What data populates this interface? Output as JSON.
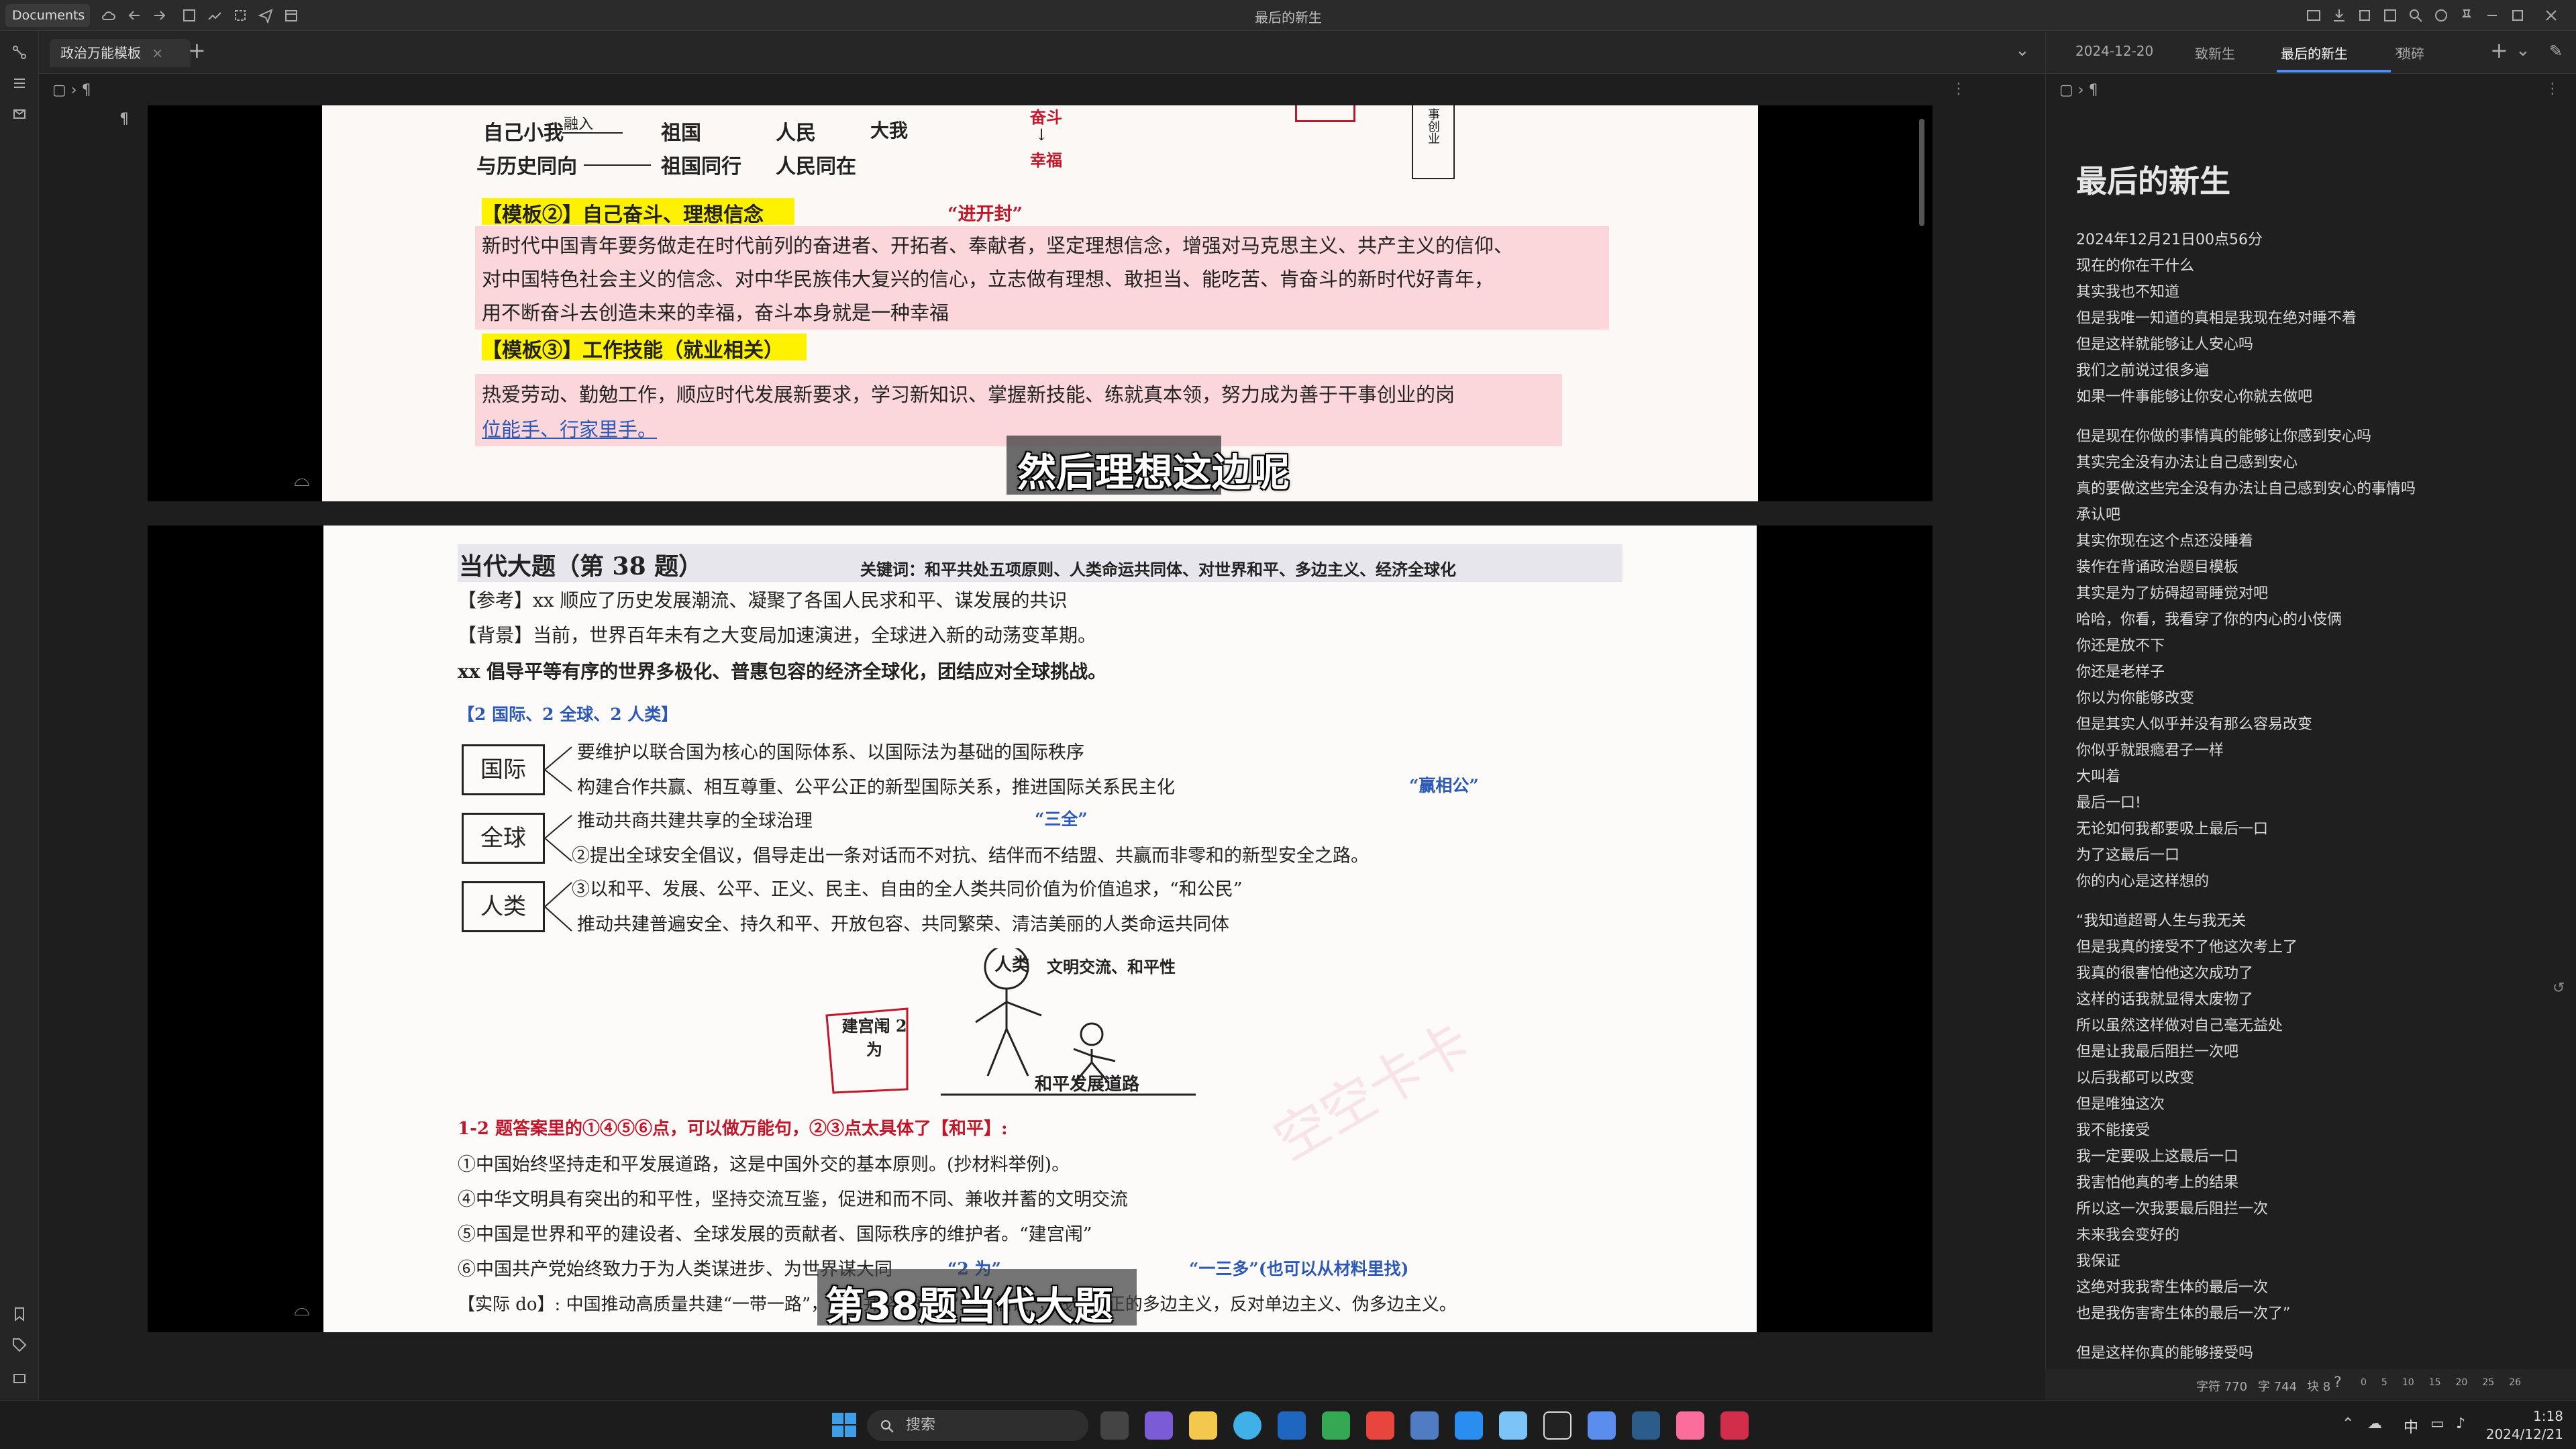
{
  "window": {
    "workspace": "Documents",
    "title": "最后的新生"
  },
  "left_pane": {
    "tab": "政治万能模板",
    "breadcrumb_symbol": "¶"
  },
  "right_pane": {
    "tabs": [
      "2024-12-20",
      "致新生",
      "最后的新生",
      "琐碎"
    ],
    "active_tab": "最后的新生",
    "note_title": "最后的新生",
    "lines": [
      "2024年12月21日00点56分",
      "现在的你在干什么",
      "其实我也不知道",
      "但是我唯一知道的真相是我现在绝对睡不着",
      "但是这样就能够让人安心吗",
      "我们之前说过很多遍",
      "如果一件事能够让你安心你就去做吧",
      "",
      "但是现在你做的事情真的能够让你感到安心吗",
      "其实完全没有办法让自己感到安心",
      "真的要做这些完全没有办法让自己感到安心的事情吗",
      "承认吧",
      "其实你现在这个点还没睡着",
      "装作在背诵政治题目模板",
      "其实是为了妨碍超哥睡觉对吧",
      "哈哈，你看，我看穿了你的内心的小伎俩",
      "你还是放不下",
      "你还是老样子",
      "你以为你能够改变",
      "但是其实人似乎并没有那么容易改变",
      "你似乎就跟瘾君子一样",
      "大叫着",
      "最后一口!",
      "无论如何我都要吸上最后一口",
      "为了这最后一口",
      "你的内心是这样想的",
      "",
      "“我知道超哥人生与我无关",
      "但是我真的接受不了他这次考上了",
      "我真的很害怕他这次成功了",
      "这样的话我就显得太废物了",
      "所以虽然这样做对自己毫无益处",
      "但是让我最后阻拦一次吧",
      "以后我都可以改变",
      "但是唯独这次",
      "我不能接受",
      "我一定要吸上这最后一口",
      "我害怕他真的考上的结果",
      "所以这一次我要最后阻拦一次",
      "未来我会变好的",
      "我保证",
      "这绝对我我寄生体的最后一次",
      "也是我伤害寄生体的最后一次了”",
      "",
      "但是这样你真的能够接受吗"
    ],
    "status": {
      "chars": "字符 770",
      "words": "字 744",
      "blocks": "块 8",
      "ticks": [
        "0",
        "5",
        "10",
        "15",
        "20",
        "25",
        "26"
      ]
    }
  },
  "image1": {
    "row1_left": "自己小我",
    "row1_arrow": "融入",
    "row1_mid": "祖国",
    "row1_right": "人民",
    "row1_far": "大我",
    "row2_left": "与历史同向",
    "row2_mid": "祖国同行",
    "row2_right": "人民同在",
    "arrow_top": "奋斗",
    "arrow_bottom": "幸福",
    "vert_text": "事创业",
    "tpl2_heading": "【模板②】自己奋斗、理想信念",
    "tpl2_tag": "“进开封”",
    "tpl2_line1": "新时代中国青年要务做走在时代前列的奋进者、开拓者、奉献者，坚定理想信念，增强对马克思主义、共产主义的信仰、",
    "tpl2_line2": "对中国特色社会主义的信念、对中华民族伟大复兴的信心，立志做有理想、敢担当、能吃苦、肯奋斗的新时代好青年，",
    "tpl2_line3": "用不断奋斗去创造未来的幸福，奋斗本身就是一种幸福",
    "tpl3_heading": "【模板③】工作技能（就业相关）",
    "tpl3_line1": "热爱劳动、勤勉工作，顺应时代发展新要求，学习新知识、掌握新技能、练就真本领，努力成为善于干事创业的岗",
    "tpl3_line2": "位能手、行家里手。",
    "subtitle": "然后理想这边呢"
  },
  "image2": {
    "title": "当代大题（第 38 题）",
    "keywords": "关键词：和平共处五项原则、人类命运共同体、对世界和平、多边主义、经济全球化",
    "line_cankao": "【参考】xx 顺应了历史发展潮流、凝聚了各国人民求和平、谋发展的共识",
    "line_beijing": "【背景】当前，世界百年未有之大变局加速演进，全球进入新的动荡变革期。",
    "line_xx": "xx 倡导平等有序的世界多极化、普惠包容的经济全球化，团结应对全球挑战。",
    "line_2guoji": "【2 国际、2 全球、2 人类】",
    "box_guoji": "国际",
    "box_quanqiu": "全球",
    "box_renlei": "人类",
    "g1": "要维护以联合国为核心的国际体系、以国际法为基础的国际秩序",
    "g2": "构建合作共赢、相互尊重、公平公正的新型国际关系，推进国际关系民主化",
    "g2_tag": "“赢相公”",
    "q1": "推动共商共建共享的全球治理",
    "q1_tag": "“三全”",
    "q2": "②提出全球安全倡议，倡导走出一条对话而不对抗、结伴而不结盟、共赢而非零和的新型安全之路。",
    "r1": "③以和平、发展、公平、正义、民主、自由的全人类共同价值为价值追求，“和公民”",
    "r2": "推动共建普遍安全、持久和平、开放包容、共同繁荣、清洁美丽的人类命运共同体",
    "fig_head": "人类",
    "fig_text": "文明交流、和平性",
    "fig_sign": "建宫闱 2为",
    "fig_road": "和平发展道路",
    "n_head": "1-2 题答案里的①④⑤⑥点，可以做万能句，②③点太具体了【和平】:",
    "n1": "①中国始终坚持走和平发展道路，这是中国外交的基本原则。(抄材料举例)。",
    "n4": "④中华文明具有突出的和平性，坚持交流互鉴，促进和而不同、兼收并蓄的文明交流",
    "n5": "⑤中国是世界和平的建设者、全球发展的贡献者、国际秩序的维护者。“建宫闱”",
    "n6": "⑥中国共产党始终致力于为人类谋进步、为世界谋大同",
    "n6_tag1": "“2 为”",
    "n6_tag2": "“一三多”(也可以从材料里找)",
    "shiji": "【实际 do】: 中国推动高质量共建“一带一路”，提出并努力落实“三大倡议”，践行真正的多边主义，反对单边主义、伪多边主义。",
    "watermark": "空空卡卡",
    "subtitle": "第38题当代大题"
  },
  "taskbar": {
    "search_placeholder": "搜索",
    "time": "1:18",
    "date": "2024/12/21",
    "ime": "中"
  },
  "colors": {
    "accent": "#4f8ef7",
    "pink": "#fbd7dc",
    "highlight": "#fff200",
    "red_text": "#c0182a"
  }
}
